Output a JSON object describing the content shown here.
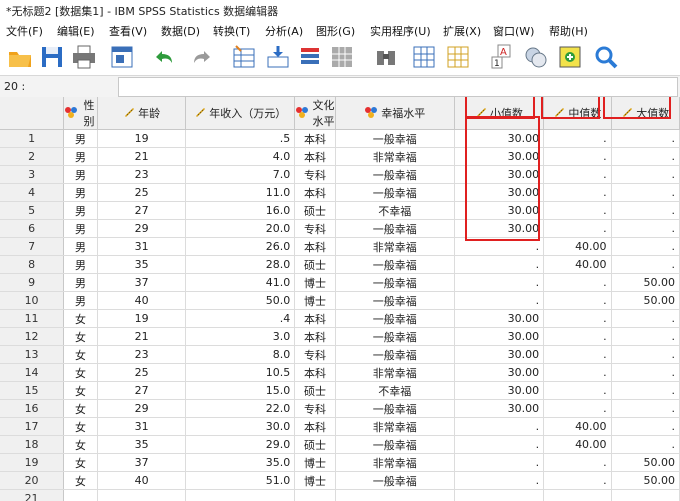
{
  "title": "*无标题2 [数据集1] - IBM SPSS Statistics 数据编辑器",
  "menu": [
    "文件(F)",
    "编辑(E)",
    "查看(V)",
    "数据(D)",
    "转换(T)",
    "分析(A)",
    "图形(G)",
    "实用程序(U)",
    "扩展(X)",
    "窗口(W)",
    "帮助(H)"
  ],
  "cell_ref": "20 :",
  "columns": [
    {
      "label": "性别",
      "type": "nominal"
    },
    {
      "label": "年龄",
      "type": "scale"
    },
    {
      "label": "年收入（万元）",
      "type": "scale"
    },
    {
      "label": "文化水平",
      "type": "nominal"
    },
    {
      "label": "幸福水平",
      "type": "nominal"
    },
    {
      "label": "小值数",
      "type": "scale"
    },
    {
      "label": "中值数",
      "type": "scale"
    },
    {
      "label": "大值数",
      "type": "scale"
    }
  ],
  "rows": [
    [
      "1",
      "男",
      "19",
      ".5",
      "本科",
      "一般幸福",
      "30.00",
      ".",
      "."
    ],
    [
      "2",
      "男",
      "21",
      "4.0",
      "本科",
      "非常幸福",
      "30.00",
      ".",
      "."
    ],
    [
      "3",
      "男",
      "23",
      "7.0",
      "专科",
      "一般幸福",
      "30.00",
      ".",
      "."
    ],
    [
      "4",
      "男",
      "25",
      "11.0",
      "本科",
      "一般幸福",
      "30.00",
      ".",
      "."
    ],
    [
      "5",
      "男",
      "27",
      "16.0",
      "硕士",
      "不幸福",
      "30.00",
      ".",
      "."
    ],
    [
      "6",
      "男",
      "29",
      "20.0",
      "专科",
      "一般幸福",
      "30.00",
      ".",
      "."
    ],
    [
      "7",
      "男",
      "31",
      "26.0",
      "本科",
      "非常幸福",
      ".",
      "40.00",
      "."
    ],
    [
      "8",
      "男",
      "35",
      "28.0",
      "硕士",
      "一般幸福",
      ".",
      "40.00",
      "."
    ],
    [
      "9",
      "男",
      "37",
      "41.0",
      "博士",
      "一般幸福",
      ".",
      ".",
      "50.00"
    ],
    [
      "10",
      "男",
      "40",
      "50.0",
      "博士",
      "一般幸福",
      ".",
      ".",
      "50.00"
    ],
    [
      "11",
      "女",
      "19",
      ".4",
      "本科",
      "一般幸福",
      "30.00",
      ".",
      "."
    ],
    [
      "12",
      "女",
      "21",
      "3.0",
      "本科",
      "一般幸福",
      "30.00",
      ".",
      "."
    ],
    [
      "13",
      "女",
      "23",
      "8.0",
      "专科",
      "一般幸福",
      "30.00",
      ".",
      "."
    ],
    [
      "14",
      "女",
      "25",
      "10.5",
      "本科",
      "非常幸福",
      "30.00",
      ".",
      "."
    ],
    [
      "15",
      "女",
      "27",
      "15.0",
      "硕士",
      "不幸福",
      "30.00",
      ".",
      "."
    ],
    [
      "16",
      "女",
      "29",
      "22.0",
      "专科",
      "一般幸福",
      "30.00",
      ".",
      "."
    ],
    [
      "17",
      "女",
      "31",
      "30.0",
      "本科",
      "非常幸福",
      ".",
      "40.00",
      "."
    ],
    [
      "18",
      "女",
      "35",
      "29.0",
      "硕士",
      "一般幸福",
      ".",
      "40.00",
      "."
    ],
    [
      "19",
      "女",
      "37",
      "35.0",
      "博士",
      "非常幸福",
      ".",
      ".",
      "50.00"
    ],
    [
      "20",
      "女",
      "40",
      "51.0",
      "博士",
      "一般幸福",
      ".",
      ".",
      "50.00"
    ],
    [
      "21",
      "",
      "",
      "",
      "",
      "",
      "",
      "",
      ""
    ]
  ]
}
